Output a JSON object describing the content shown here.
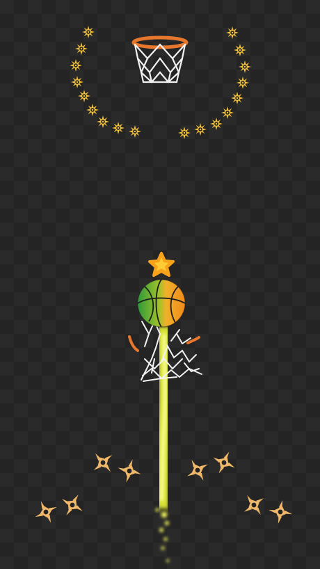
{
  "game": {
    "theme_colors": {
      "background": "#242424",
      "checker": "#2c2c2c",
      "hoop_rim": "#e8772e",
      "net": "#f2f2f2",
      "star_decor": "#f3c13a",
      "shuriken": "#f0b869",
      "ball_green": "#3fae3a",
      "ball_orange": "#f5a623",
      "trail": "#f6f41e",
      "bonus_star": "#f7a21b"
    },
    "icons": {
      "laurel_star": "star-burst-icon",
      "shuriken": "shuriken-icon",
      "bonus": "star-icon",
      "hoop": "basketball-hoop-icon",
      "ball": "basketball-icon"
    }
  }
}
